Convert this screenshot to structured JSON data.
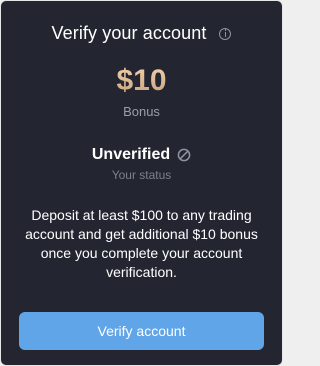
{
  "card": {
    "title": "Verify your account",
    "info_icon": "info-icon",
    "bonus_amount": "$10",
    "bonus_label": "Bonus",
    "status": "Unverified",
    "status_icon": "ban-icon",
    "status_caption": "Your status",
    "description": "Deposit at least $100 to any trading account and get additional $10 bonus once you complete your account verification.",
    "button_label": "Verify account"
  },
  "colors": {
    "background": "#232631",
    "accent_gold": "#d7b48f",
    "button_blue": "#5fa5e8",
    "muted_text": "#9a9ea9"
  }
}
